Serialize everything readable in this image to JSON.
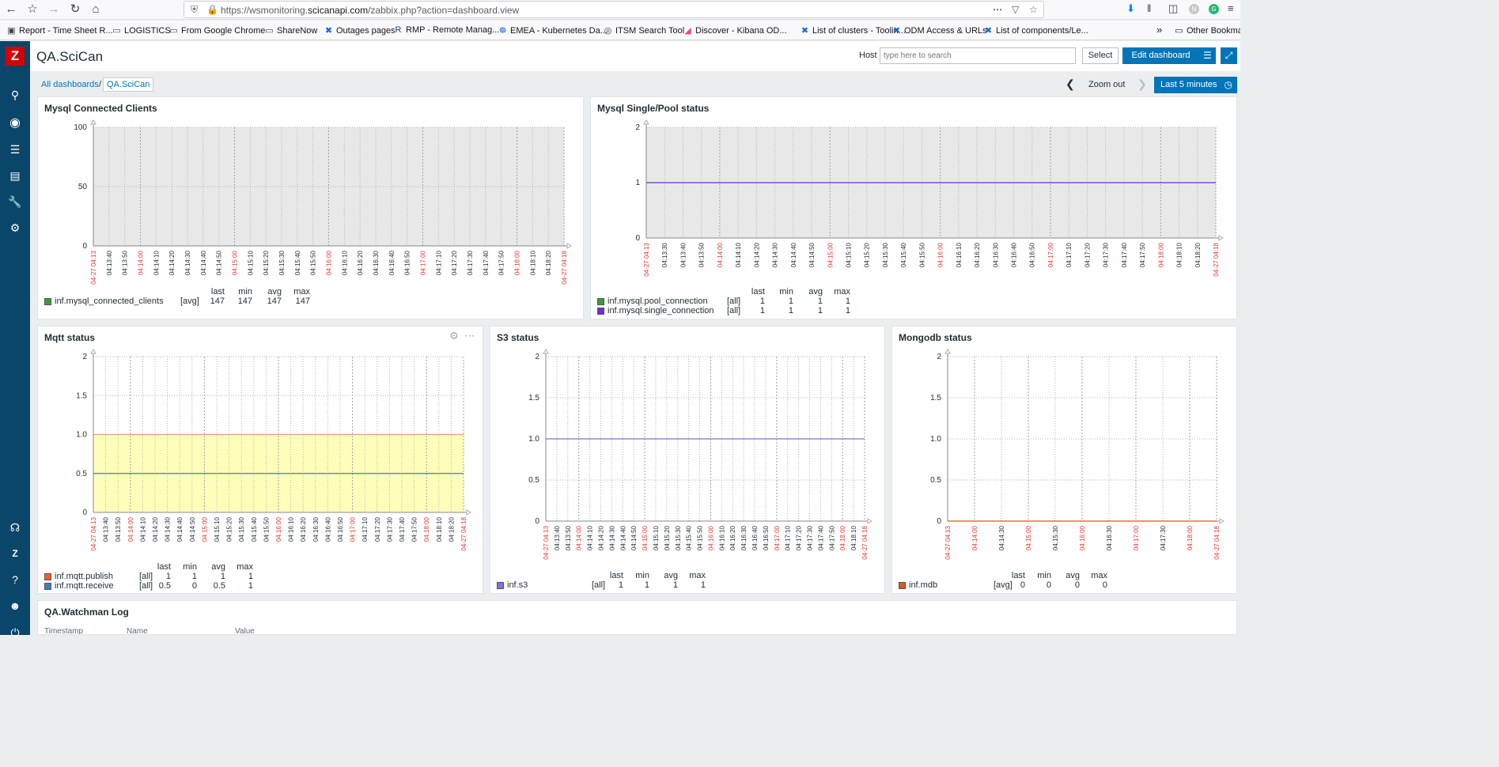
{
  "browser": {
    "url_prefix": "https://wsmonitoring.",
    "url_domain": "scicanapi.com",
    "url_path": "/zabbix.php?action=dashboard.view",
    "bookmarks": [
      {
        "label": "Report - Time Sheet R...",
        "icon": "page-icon"
      },
      {
        "label": "LOGISTICS",
        "icon": "folder-icon"
      },
      {
        "label": "From Google Chrome",
        "icon": "folder-icon"
      },
      {
        "label": "ShareNow",
        "icon": "folder-icon"
      },
      {
        "label": "Outages pages",
        "icon": "confluence-icon"
      },
      {
        "label": "RMP - Remote Manag...",
        "icon": "r-icon"
      },
      {
        "label": "EMEA - Kubernetes Da...",
        "icon": "kubernetes-icon"
      },
      {
        "label": "ITSM Search Tool",
        "icon": "globe-icon"
      },
      {
        "label": "Discover - Kibana OD...",
        "icon": "kibana-icon"
      },
      {
        "label": "List of clusters - Toolin...",
        "icon": "confluence-icon"
      },
      {
        "label": "ODM Access & URLs",
        "icon": "confluence-icon"
      },
      {
        "label": "List of components/Le...",
        "icon": "confluence-icon"
      }
    ],
    "other_bookmarks": "Other Bookmarks"
  },
  "header": {
    "title": "QA.SciCan",
    "host_label": "Host",
    "host_placeholder": "type here to search",
    "select_label": "Select",
    "edit_label": "Edit dashboard"
  },
  "breadcrumb": {
    "all": "All dashboards",
    "sep": "/",
    "current": "QA.SciCan"
  },
  "timebar": {
    "zoom_out": "Zoom out",
    "period": "Last 5 minutes"
  },
  "legend_headers": [
    "last",
    "min",
    "avg",
    "max"
  ],
  "widgets": [
    {
      "id": "mysql-clients",
      "title": "Mysql Connected Clients",
      "chart_data": {
        "type": "line",
        "yticks": [
          "100",
          "50",
          "0"
        ],
        "ylim": [
          0,
          100
        ],
        "xticks": [
          "04-27 04:13",
          "04:13:40",
          "04:13:50",
          "04:14:00",
          "04:14:10",
          "04:14:20",
          "04:14:30",
          "04:14:40",
          "04:14:50",
          "04:15:00",
          "04:15:10",
          "04:15:20",
          "04:15:30",
          "04:15:40",
          "04:15:50",
          "04:16:00",
          "04:16:10",
          "04:16:20",
          "04:16:30",
          "04:16:40",
          "04:16:50",
          "04:17:00",
          "04:17:10",
          "04:17:20",
          "04:17:30",
          "04:17:40",
          "04:17:50",
          "04:18:00",
          "04:18:10",
          "04:18:20",
          "04-27 04:18"
        ],
        "red_ticks": [
          "04-27 04:13",
          "04:14:00",
          "04:15:00",
          "04:16:00",
          "04:17:00",
          "04:18:00",
          "04-27 04:18"
        ],
        "background": "gray",
        "series": [
          {
            "name": "inf.mysql_connected_clients",
            "func": "[avg]",
            "color": "#3c9a3c",
            "last": "147",
            "min": "147",
            "avg": "147",
            "max": "147"
          }
        ]
      }
    },
    {
      "id": "mysql-pool",
      "title": "Mysql Single/Pool status",
      "chart_data": {
        "type": "line",
        "yticks": [
          "2",
          "1",
          "0"
        ],
        "ylim": [
          0,
          2
        ],
        "xticks": [
          "04-27 04:13",
          "04:13:30",
          "04:13:40",
          "04:13:50",
          "04:14:00",
          "04:14:10",
          "04:14:20",
          "04:14:30",
          "04:14:40",
          "04:14:50",
          "04:15:00",
          "04:15:10",
          "04:15:20",
          "04:15:30",
          "04:15:40",
          "04:15:50",
          "04:16:00",
          "04:16:10",
          "04:16:20",
          "04:16:30",
          "04:16:40",
          "04:16:50",
          "04:17:00",
          "04:17:10",
          "04:17:20",
          "04:17:30",
          "04:17:40",
          "04:17:50",
          "04:18:00",
          "04:18:10",
          "04:18:20",
          "04-27 04:18"
        ],
        "red_ticks": [
          "04-27 04:13",
          "04:14:00",
          "04:15:00",
          "04:16:00",
          "04:17:00",
          "04:18:00",
          "04-27 04:18"
        ],
        "background": "gray",
        "lines": [
          {
            "value": 1,
            "color": "#6a2fd6"
          }
        ],
        "series": [
          {
            "name": "inf.mysql.pool_connection",
            "func": "[all]",
            "color": "#3c9a3c",
            "last": "1",
            "min": "1",
            "avg": "1",
            "max": "1"
          },
          {
            "name": "inf.mysql.single_connection",
            "func": "[all]",
            "color": "#6a2fd6",
            "last": "1",
            "min": "1",
            "avg": "1",
            "max": "1"
          }
        ]
      }
    },
    {
      "id": "mqtt",
      "title": "Mqtt status",
      "chart_data": {
        "type": "area",
        "yticks": [
          "2",
          "1.5",
          "1.0",
          "0.5",
          "0"
        ],
        "ylim": [
          0,
          2
        ],
        "xticks": [
          "04-27 04:13",
          "04:13:40",
          "04:13:50",
          "04:14:00",
          "04:14:10",
          "04:14:20",
          "04:14:30",
          "04:14:40",
          "04:14:50",
          "04:15:00",
          "04:15:10",
          "04:15:20",
          "04:15:30",
          "04:15:40",
          "04:15:50",
          "04:16:00",
          "04:16:10",
          "04:16:20",
          "04:16:30",
          "04:16:40",
          "04:16:50",
          "04:17:00",
          "04:17:10",
          "04:17:20",
          "04:17:30",
          "04:17:40",
          "04:17:50",
          "04:18:00",
          "04:18:10",
          "04:18:20",
          "04-27 04:18"
        ],
        "red_ticks": [
          "04-27 04:13",
          "04:14:00",
          "04:15:00",
          "04:16:00",
          "04:17:00",
          "04:18:00",
          "04-27 04:18"
        ],
        "background": "white",
        "fill": {
          "value": 1,
          "color": "#ffffb9",
          "border": "#ff8c55"
        },
        "lines": [
          {
            "value": 0.5,
            "color": "#3a7fc0"
          }
        ],
        "series": [
          {
            "name": "inf.mqtt.publish",
            "func": "[all]",
            "color": "#ff5a1f",
            "last": "1",
            "min": "1",
            "avg": "1",
            "max": "1"
          },
          {
            "name": "inf.mqtt.receive",
            "func": "[all]",
            "color": "#3a7fc0",
            "last": "0.5",
            "min": "0",
            "avg": "0.5",
            "max": "1"
          }
        ]
      }
    },
    {
      "id": "s3",
      "title": "S3 status",
      "chart_data": {
        "type": "line",
        "yticks": [
          "2",
          "1.5",
          "1.0",
          "0.5",
          "0"
        ],
        "ylim": [
          0,
          2
        ],
        "xticks": [
          "04-27 04:13",
          "04:13:40",
          "04:13:50",
          "04:14:00",
          "04:14:10",
          "04:14:20",
          "04:14:30",
          "04:14:40",
          "04:14:50",
          "04:15:00",
          "04:15:10",
          "04:15:20",
          "04:15:30",
          "04:15:40",
          "04:15:50",
          "04:16:00",
          "04:16:10",
          "04:16:20",
          "04:16:30",
          "04:16:40",
          "04:16:50",
          "04:17:00",
          "04:17:10",
          "04:17:20",
          "04:17:30",
          "04:17:40",
          "04:17:50",
          "04:18:00",
          "04:18:10",
          "04-27 04:18"
        ],
        "red_ticks": [
          "04-27 04:13",
          "04:14:00",
          "04:15:00",
          "04:16:00",
          "04:17:00",
          "04:18:00",
          "04-27 04:18"
        ],
        "background": "white",
        "lines": [
          {
            "value": 1,
            "color": "#7b70e6"
          }
        ],
        "series": [
          {
            "name": "inf.s3",
            "func": "[all]",
            "color": "#7b70e6",
            "last": "1",
            "min": "1",
            "avg": "1",
            "max": "1"
          }
        ]
      }
    },
    {
      "id": "mongodb",
      "title": "Mongodb status",
      "chart_data": {
        "type": "line",
        "yticks": [
          "2",
          "1.5",
          "1.0",
          "0.5",
          "0"
        ],
        "ylim": [
          0,
          2
        ],
        "xticks": [
          "04-27 04:13",
          "04:14:00",
          "04:14:30",
          "04:15:00",
          "04:15:30",
          "04:16:00",
          "04:16:30",
          "04:17:00",
          "04:17:30",
          "04:18:00",
          "04-27 04:18"
        ],
        "red_ticks": [
          "04-27 04:13",
          "04:14:00",
          "04:15:00",
          "04:16:00",
          "04:17:00",
          "04:18:00",
          "04-27 04:18"
        ],
        "background": "white",
        "lines": [
          {
            "value": 0,
            "color": "#e8501e"
          }
        ],
        "series": [
          {
            "name": "inf.mdb",
            "func": "[avg]",
            "color": "#e8501e",
            "last": "0",
            "min": "0",
            "avg": "0",
            "max": "0"
          }
        ]
      }
    }
  ],
  "watchman": {
    "title": "QA.Watchman Log",
    "columns": [
      "Timestamp",
      "Name",
      "Value"
    ]
  }
}
